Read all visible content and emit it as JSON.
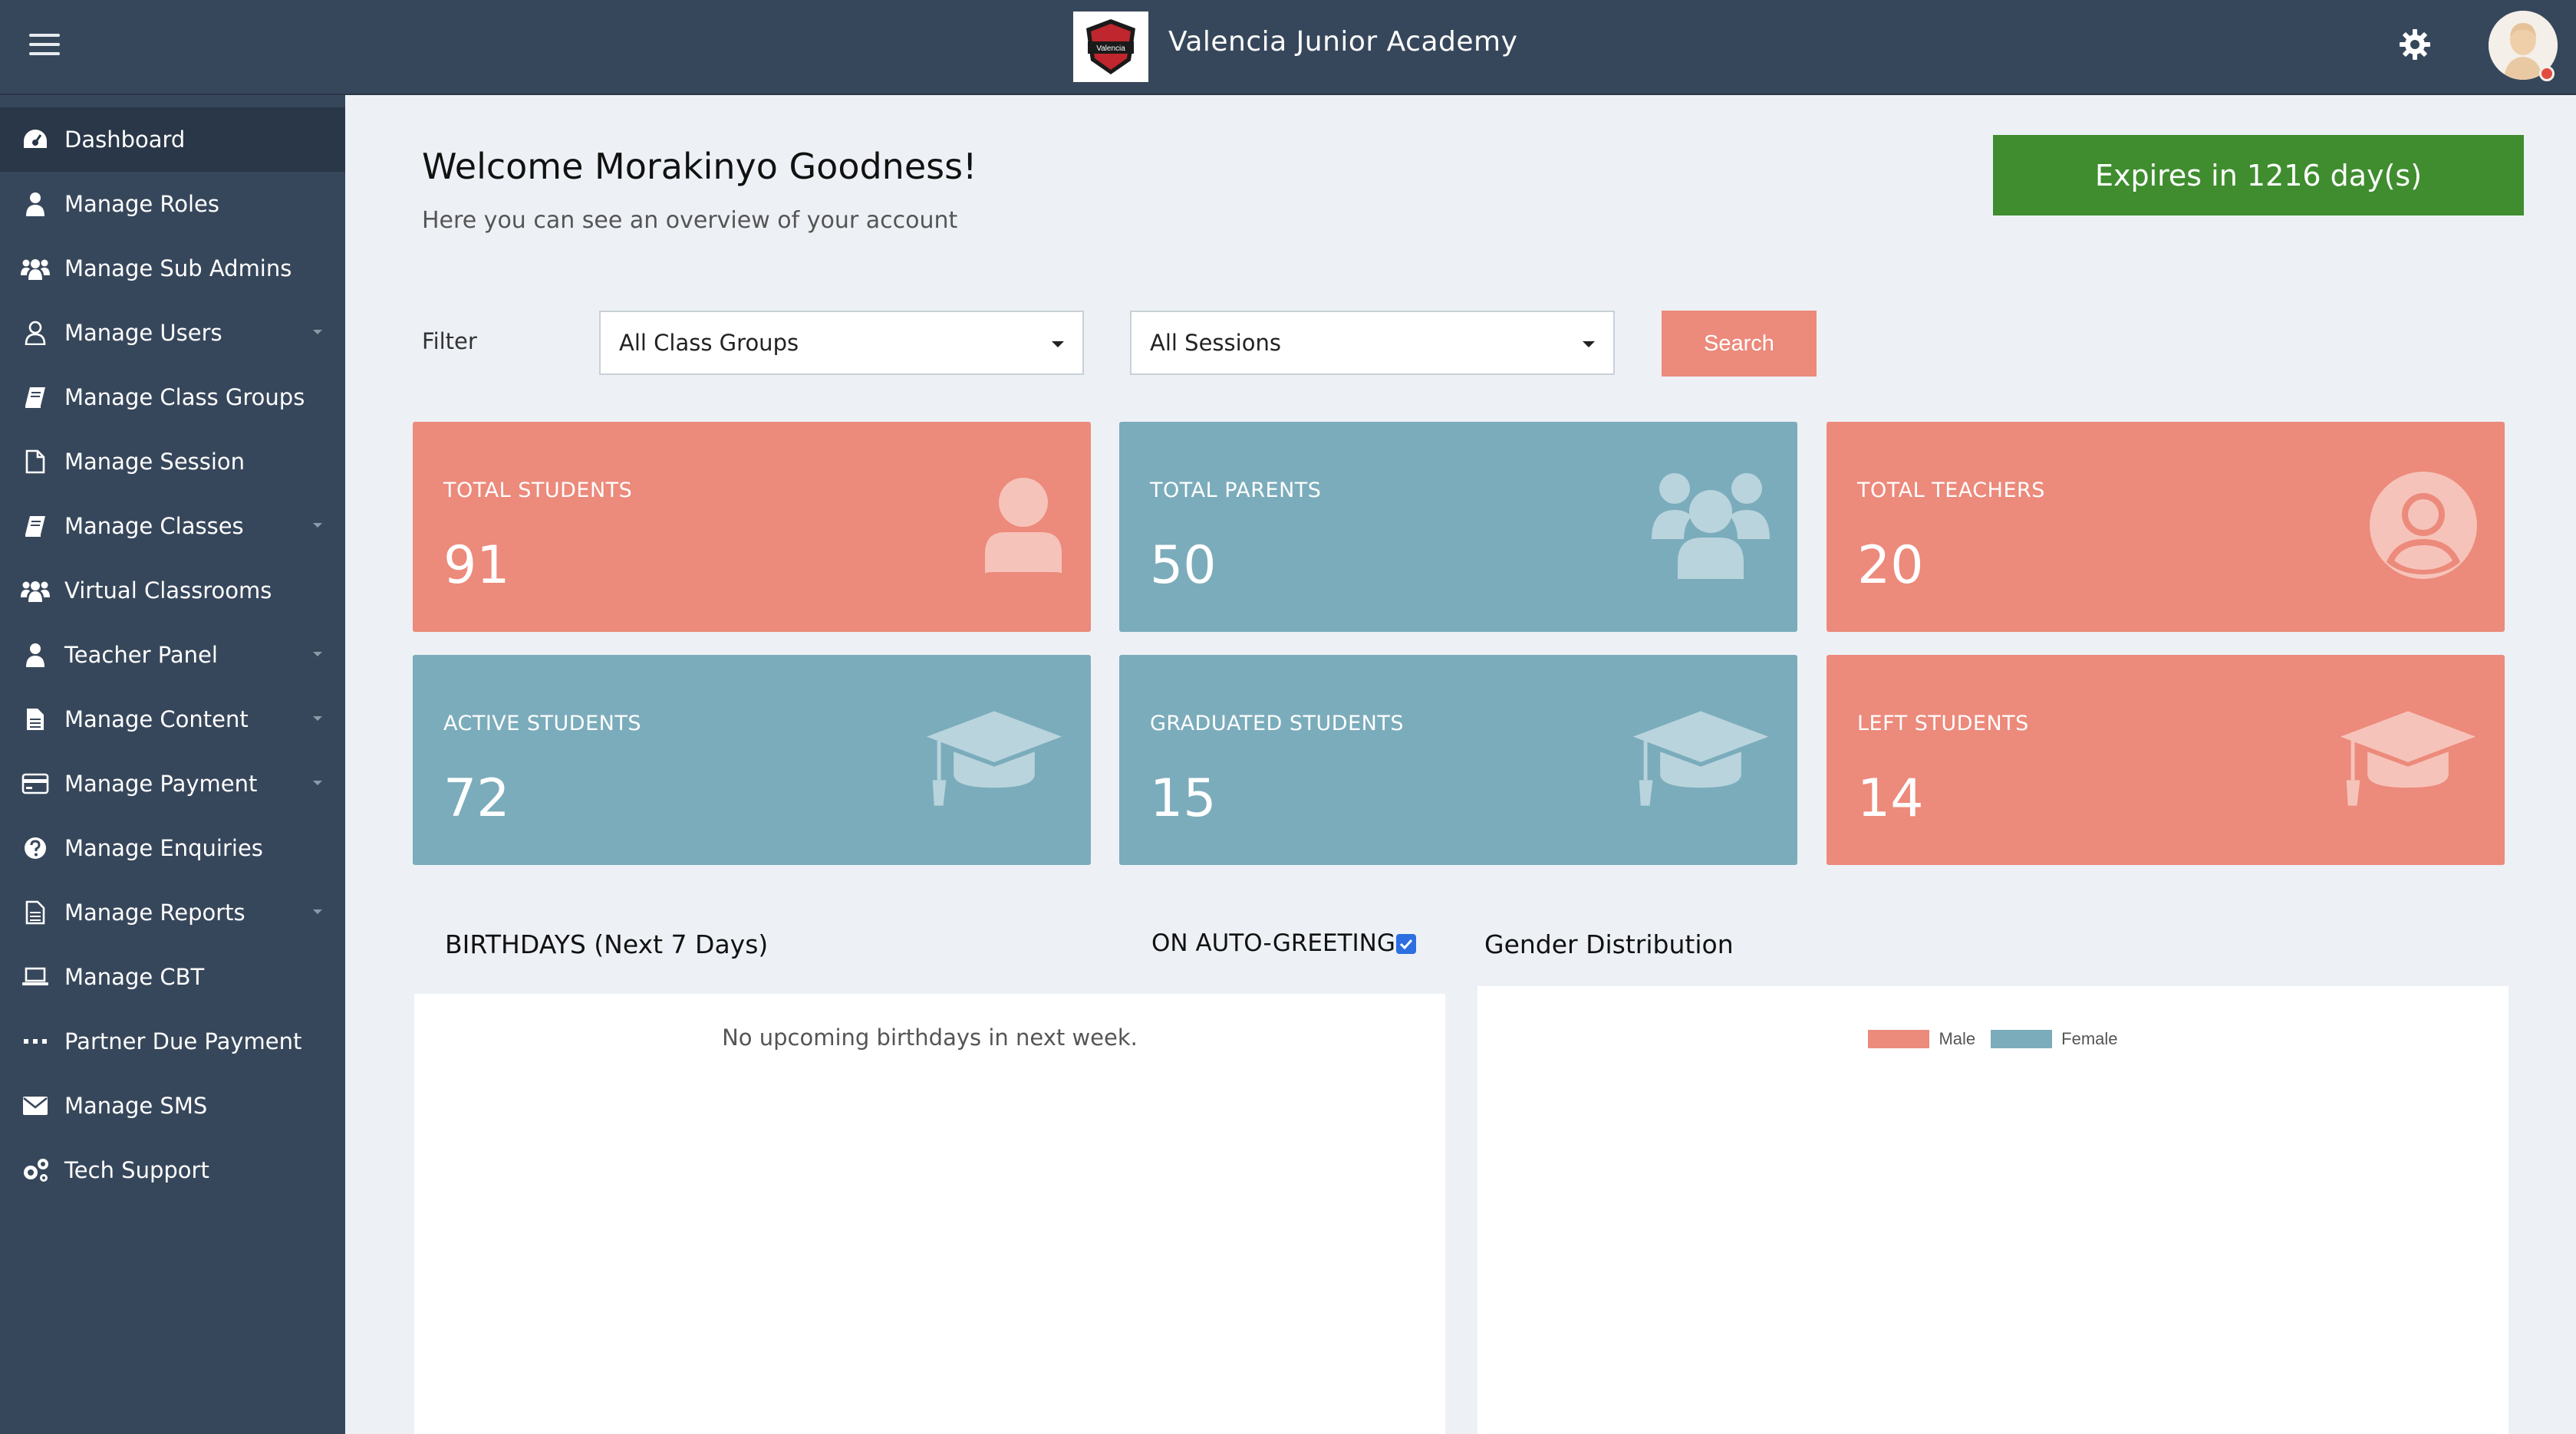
{
  "header": {
    "brand_name": "Valencia Junior Academy",
    "logo_text": "Valencia",
    "menu_icon": "hamburger-menu-icon",
    "settings_icon": "gear-icon",
    "avatar_icon": "user-avatar"
  },
  "sidebar": {
    "items": [
      {
        "label": "Dashboard",
        "icon": "dashboard-gauge-icon",
        "active": true,
        "has_caret": false
      },
      {
        "label": "Manage Roles",
        "icon": "user-icon",
        "has_caret": false
      },
      {
        "label": "Manage Sub Admins",
        "icon": "users-icon",
        "has_caret": false
      },
      {
        "label": "Manage Users",
        "icon": "user-outline-icon",
        "has_caret": true
      },
      {
        "label": "Manage Class Groups",
        "icon": "book-icon",
        "has_caret": false
      },
      {
        "label": "Manage Session",
        "icon": "file-icon",
        "has_caret": false
      },
      {
        "label": "Manage Classes",
        "icon": "book-icon",
        "has_caret": true
      },
      {
        "label": "Virtual Classrooms",
        "icon": "users-icon",
        "has_caret": false
      },
      {
        "label": "Teacher Panel",
        "icon": "user-icon",
        "has_caret": true
      },
      {
        "label": "Manage Content",
        "icon": "file-text-icon",
        "has_caret": true
      },
      {
        "label": "Manage Payment",
        "icon": "credit-card-icon",
        "has_caret": true
      },
      {
        "label": "Manage Enquiries",
        "icon": "question-circle-icon",
        "has_caret": false
      },
      {
        "label": "Manage Reports",
        "icon": "file-text-outline-icon",
        "has_caret": true
      },
      {
        "label": "Manage CBT",
        "icon": "laptop-icon",
        "has_caret": false
      },
      {
        "label": "Partner Due Payment",
        "icon": "ellipsis-icon",
        "has_caret": false
      },
      {
        "label": "Manage SMS",
        "icon": "envelope-icon",
        "has_caret": false
      },
      {
        "label": "Tech Support",
        "icon": "cogs-icon",
        "has_caret": false
      }
    ]
  },
  "welcome": {
    "title": "Welcome Morakinyo Goodness!",
    "subtitle": "Here you can see an overview of your account",
    "expires": "Expires in 1216 day(s)"
  },
  "filter": {
    "label": "Filter",
    "class_group": "All Class Groups",
    "session": "All Sessions",
    "search_label": "Search"
  },
  "stats": [
    {
      "label": "TOTAL STUDENTS",
      "value": "91",
      "icon": "user-icon",
      "color": "#ec8a7b"
    },
    {
      "label": "TOTAL PARENTS",
      "value": "50",
      "icon": "users-icon",
      "color": "#7bacbb"
    },
    {
      "label": "TOTAL TEACHERS",
      "value": "20",
      "icon": "user-circle-icon",
      "color": "#ec8a7b"
    },
    {
      "label": "ACTIVE STUDENTS",
      "value": "72",
      "icon": "graduation-cap-icon",
      "color": "#7bacbb"
    },
    {
      "label": "GRADUATED STUDENTS",
      "value": "15",
      "icon": "graduation-cap-icon",
      "color": "#7bacbb"
    },
    {
      "label": "LEFT STUDENTS",
      "value": "14",
      "icon": "graduation-cap-icon",
      "color": "#ec8a7b"
    }
  ],
  "birthdays": {
    "title": "BIRTHDAYS (Next 7 Days)",
    "auto_greeting_label": "ON AUTO-GREETING",
    "auto_greeting_checked": true,
    "empty_text": "No upcoming birthdays in next week."
  },
  "gender": {
    "title": "Gender Distribution",
    "legend": [
      {
        "name": "Male",
        "color": "#ec8a7b"
      },
      {
        "name": "Female",
        "color": "#7bacbb"
      }
    ]
  }
}
